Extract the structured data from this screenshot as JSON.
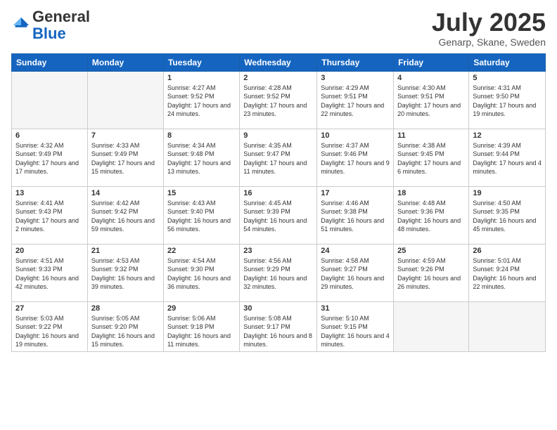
{
  "logo": {
    "general": "General",
    "blue": "Blue"
  },
  "header": {
    "month": "July 2025",
    "location": "Genarp, Skane, Sweden"
  },
  "weekdays": [
    "Sunday",
    "Monday",
    "Tuesday",
    "Wednesday",
    "Thursday",
    "Friday",
    "Saturday"
  ],
  "weeks": [
    [
      {
        "day": "",
        "info": ""
      },
      {
        "day": "",
        "info": ""
      },
      {
        "day": "1",
        "info": "Sunrise: 4:27 AM\nSunset: 9:52 PM\nDaylight: 17 hours and 24 minutes."
      },
      {
        "day": "2",
        "info": "Sunrise: 4:28 AM\nSunset: 9:52 PM\nDaylight: 17 hours and 23 minutes."
      },
      {
        "day": "3",
        "info": "Sunrise: 4:29 AM\nSunset: 9:51 PM\nDaylight: 17 hours and 22 minutes."
      },
      {
        "day": "4",
        "info": "Sunrise: 4:30 AM\nSunset: 9:51 PM\nDaylight: 17 hours and 20 minutes."
      },
      {
        "day": "5",
        "info": "Sunrise: 4:31 AM\nSunset: 9:50 PM\nDaylight: 17 hours and 19 minutes."
      }
    ],
    [
      {
        "day": "6",
        "info": "Sunrise: 4:32 AM\nSunset: 9:49 PM\nDaylight: 17 hours and 17 minutes."
      },
      {
        "day": "7",
        "info": "Sunrise: 4:33 AM\nSunset: 9:49 PM\nDaylight: 17 hours and 15 minutes."
      },
      {
        "day": "8",
        "info": "Sunrise: 4:34 AM\nSunset: 9:48 PM\nDaylight: 17 hours and 13 minutes."
      },
      {
        "day": "9",
        "info": "Sunrise: 4:35 AM\nSunset: 9:47 PM\nDaylight: 17 hours and 11 minutes."
      },
      {
        "day": "10",
        "info": "Sunrise: 4:37 AM\nSunset: 9:46 PM\nDaylight: 17 hours and 9 minutes."
      },
      {
        "day": "11",
        "info": "Sunrise: 4:38 AM\nSunset: 9:45 PM\nDaylight: 17 hours and 6 minutes."
      },
      {
        "day": "12",
        "info": "Sunrise: 4:39 AM\nSunset: 9:44 PM\nDaylight: 17 hours and 4 minutes."
      }
    ],
    [
      {
        "day": "13",
        "info": "Sunrise: 4:41 AM\nSunset: 9:43 PM\nDaylight: 17 hours and 2 minutes."
      },
      {
        "day": "14",
        "info": "Sunrise: 4:42 AM\nSunset: 9:42 PM\nDaylight: 16 hours and 59 minutes."
      },
      {
        "day": "15",
        "info": "Sunrise: 4:43 AM\nSunset: 9:40 PM\nDaylight: 16 hours and 56 minutes."
      },
      {
        "day": "16",
        "info": "Sunrise: 4:45 AM\nSunset: 9:39 PM\nDaylight: 16 hours and 54 minutes."
      },
      {
        "day": "17",
        "info": "Sunrise: 4:46 AM\nSunset: 9:38 PM\nDaylight: 16 hours and 51 minutes."
      },
      {
        "day": "18",
        "info": "Sunrise: 4:48 AM\nSunset: 9:36 PM\nDaylight: 16 hours and 48 minutes."
      },
      {
        "day": "19",
        "info": "Sunrise: 4:50 AM\nSunset: 9:35 PM\nDaylight: 16 hours and 45 minutes."
      }
    ],
    [
      {
        "day": "20",
        "info": "Sunrise: 4:51 AM\nSunset: 9:33 PM\nDaylight: 16 hours and 42 minutes."
      },
      {
        "day": "21",
        "info": "Sunrise: 4:53 AM\nSunset: 9:32 PM\nDaylight: 16 hours and 39 minutes."
      },
      {
        "day": "22",
        "info": "Sunrise: 4:54 AM\nSunset: 9:30 PM\nDaylight: 16 hours and 36 minutes."
      },
      {
        "day": "23",
        "info": "Sunrise: 4:56 AM\nSunset: 9:29 PM\nDaylight: 16 hours and 32 minutes."
      },
      {
        "day": "24",
        "info": "Sunrise: 4:58 AM\nSunset: 9:27 PM\nDaylight: 16 hours and 29 minutes."
      },
      {
        "day": "25",
        "info": "Sunrise: 4:59 AM\nSunset: 9:26 PM\nDaylight: 16 hours and 26 minutes."
      },
      {
        "day": "26",
        "info": "Sunrise: 5:01 AM\nSunset: 9:24 PM\nDaylight: 16 hours and 22 minutes."
      }
    ],
    [
      {
        "day": "27",
        "info": "Sunrise: 5:03 AM\nSunset: 9:22 PM\nDaylight: 16 hours and 19 minutes."
      },
      {
        "day": "28",
        "info": "Sunrise: 5:05 AM\nSunset: 9:20 PM\nDaylight: 16 hours and 15 minutes."
      },
      {
        "day": "29",
        "info": "Sunrise: 5:06 AM\nSunset: 9:18 PM\nDaylight: 16 hours and 11 minutes."
      },
      {
        "day": "30",
        "info": "Sunrise: 5:08 AM\nSunset: 9:17 PM\nDaylight: 16 hours and 8 minutes."
      },
      {
        "day": "31",
        "info": "Sunrise: 5:10 AM\nSunset: 9:15 PM\nDaylight: 16 hours and 4 minutes."
      },
      {
        "day": "",
        "info": ""
      },
      {
        "day": "",
        "info": ""
      }
    ]
  ]
}
